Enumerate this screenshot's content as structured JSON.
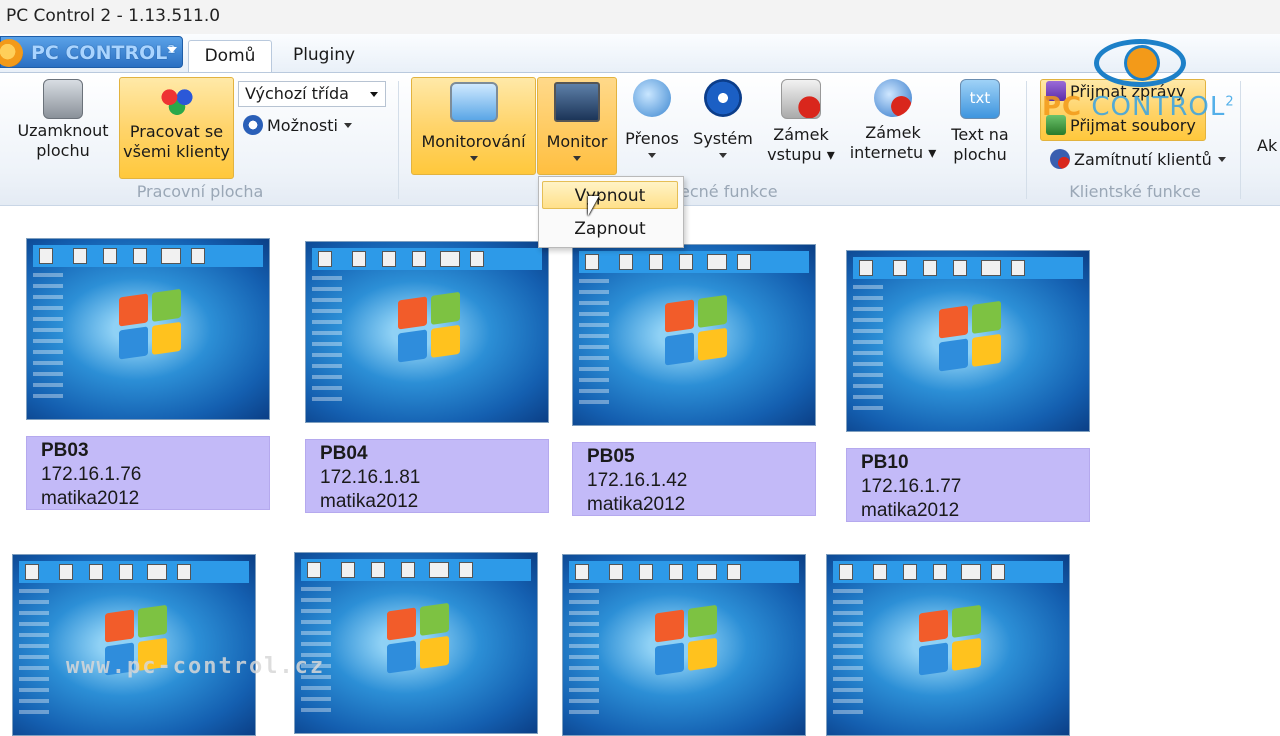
{
  "window": {
    "title": "PC Control 2 - 1.13.511.0"
  },
  "app_button": {
    "logo_text": "PC CONTROL²"
  },
  "tabs": [
    {
      "label": "Domů"
    },
    {
      "label": "Pluginy"
    }
  ],
  "ribbon": {
    "workspace": {
      "group_label": "Pracovní plocha",
      "lock_desktop": {
        "line1": "Uzamknout",
        "line2": "plochu"
      },
      "work_all": {
        "line1": "Pracovat se",
        "line2": "všemi klienty"
      },
      "class_combo": {
        "value": "Výchozí třída"
      },
      "options": {
        "label": "Možnosti"
      }
    },
    "common": {
      "group_label_partial": "ecné funkce",
      "monitoring": {
        "label": "Monitorování"
      },
      "monitor": {
        "label": "Monitor"
      },
      "transfer": {
        "label": "Přenos"
      },
      "system": {
        "label": "Systém"
      },
      "input_lock": {
        "line1": "Zámek",
        "line2": "vstupu"
      },
      "internet_lock": {
        "line1": "Zámek",
        "line2": "internetu"
      },
      "text_desktop": {
        "line1": "Text na",
        "line2": "plochu",
        "icon_text": "txt"
      }
    },
    "client": {
      "group_label": "Klientské funkce",
      "receive_messages": {
        "label": "Přijmat zprávy"
      },
      "receive_files": {
        "label": "Přijmat soubory"
      },
      "rejected_clients": {
        "label": "Zamítnutí klientů"
      },
      "next_partial": "Ak"
    }
  },
  "monitor_menu": {
    "items": [
      {
        "label": "Vypnout"
      },
      {
        "label": "Zapnout"
      }
    ]
  },
  "brand": {
    "name_pc": "PC",
    "name_control": "CONTROL",
    "version": "2"
  },
  "clients": [
    {
      "name": "PB03",
      "ip": "172.16.1.76",
      "class": "matika2012"
    },
    {
      "name": "PB04",
      "ip": "172.16.1.81",
      "class": "matika2012"
    },
    {
      "name": "PB05",
      "ip": "172.16.1.42",
      "class": "matika2012"
    },
    {
      "name": "PB10",
      "ip": "172.16.1.77",
      "class": "matika2012"
    }
  ],
  "watermark": {
    "text": "www.pc-control.cz"
  },
  "colors": {
    "accent_highlight": "#ffd46b",
    "client_label_bg": "#c3baf8",
    "brand_blue": "#1d80c8",
    "brand_orange": "#f39a19"
  }
}
